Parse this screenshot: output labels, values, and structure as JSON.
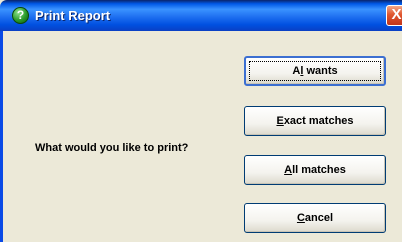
{
  "window": {
    "title": "Print Report",
    "help_icon": "question-mark-icon",
    "close_icon": "close-icon",
    "close_label": "X"
  },
  "prompt": "What would you like to print?",
  "buttons": [
    {
      "id": "all-wants",
      "mnemonic": "l",
      "label_pre": "A",
      "label_post": " wants"
    },
    {
      "id": "exact-matches",
      "mnemonic": "E",
      "label_pre": "",
      "label_post": "xact matches"
    },
    {
      "id": "all-matches",
      "mnemonic": "A",
      "label_pre": "",
      "label_post": "ll matches"
    },
    {
      "id": "cancel",
      "mnemonic": "C",
      "label_pre": "",
      "label_post": "ancel"
    }
  ],
  "colors": {
    "titlebar": "#0058e6",
    "dialog_bg": "#ece9d8",
    "close": "#e0562f"
  }
}
